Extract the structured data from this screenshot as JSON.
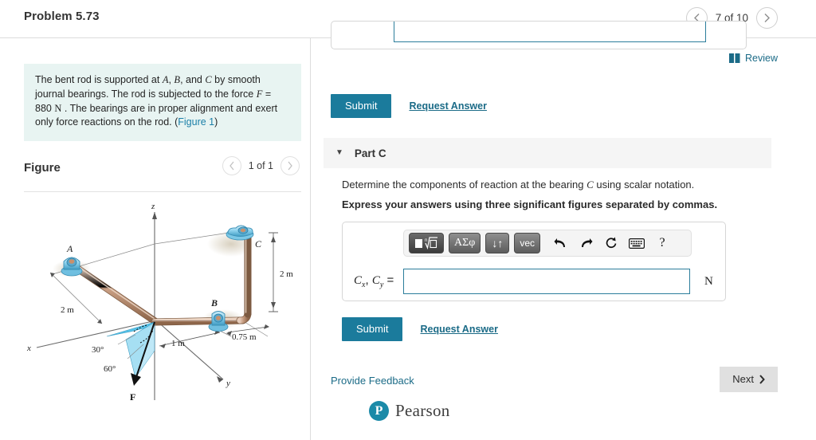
{
  "header": {
    "problem_title": "Problem 5.73",
    "prev_icon": "chevron-left-icon",
    "next_icon": "chevron-right-icon",
    "pager_label": "7 of 10"
  },
  "left": {
    "statement": {
      "part1": "The bent rod is supported at ",
      "a": "A",
      "comma1": ", ",
      "b": "B",
      "and": ", and ",
      "c": "C",
      "part2": " by smooth journal bearings. The rod is subjected to the force ",
      "f": "F",
      "equals": " = 880 ",
      "n": "N",
      "part3": " . The bearings are in proper alignment and exert only force reactions on the rod. (",
      "figure_link": "Figure 1",
      "part4": ")"
    },
    "figure_title": "Figure",
    "figure_pager_label": "1 of 1"
  },
  "figure": {
    "axis_z": "z",
    "axis_x": "x",
    "axis_y": "y",
    "point_a": "A",
    "point_b": "B",
    "point_c": "C",
    "dim_2m_left": "2 m",
    "dim_2m_right": "2 m",
    "dim_1m": "1 m",
    "dim_075m": "0.75 m",
    "angle_30": "30°",
    "angle_60": "60°",
    "force_label": "F",
    "colors": {
      "rod": "#c49a82",
      "rod_dark": "#9a6e53",
      "bearing": "#8fd2ec",
      "bearing_dark": "#4aa8cc",
      "shade": "#5bc4e8"
    }
  },
  "right": {
    "review": {
      "icon": "book-icon",
      "label": "Review"
    },
    "prev_submit_label": "Submit",
    "prev_request_label": "Request Answer",
    "part_c": {
      "caret_icon": "caret-down-icon",
      "label": "Part C",
      "prompt_part1": "Determine the components of reaction at the bearing ",
      "prompt_c": "C",
      "prompt_part2": " using scalar notation.",
      "instruction": "Express your answers using three significant figures separated by commas."
    },
    "toolbar": {
      "template_key": "template-radical-icon",
      "greek_key": "ΑΣφ",
      "arrows_key": "↓↑",
      "vec_key": "vec",
      "undo_icon": "undo-arrow-icon",
      "redo_icon": "redo-arrow-icon",
      "reset_icon": "reset-circle-icon",
      "keyboard_icon": "keyboard-icon",
      "help_icon": "?"
    },
    "answer": {
      "label_cx": "C",
      "label_cx_sub": "x",
      "label_sep": ", ",
      "label_cy": "C",
      "label_cy_sub": "y",
      "label_eq": " =",
      "value": "",
      "placeholder": "",
      "unit": "N"
    },
    "submit_label": "Submit",
    "request_label": "Request Answer",
    "provide_feedback": "Provide Feedback",
    "next_label": "Next",
    "next_icon": "chevron-right-icon",
    "pearson": {
      "mark": "P",
      "word": "Pearson"
    }
  },
  "colors": {
    "accent_teal": "#1b7b9c",
    "link_teal": "#1b6b87",
    "statement_bg": "#e8f4f2",
    "panel_gray": "#f5f5f5"
  }
}
